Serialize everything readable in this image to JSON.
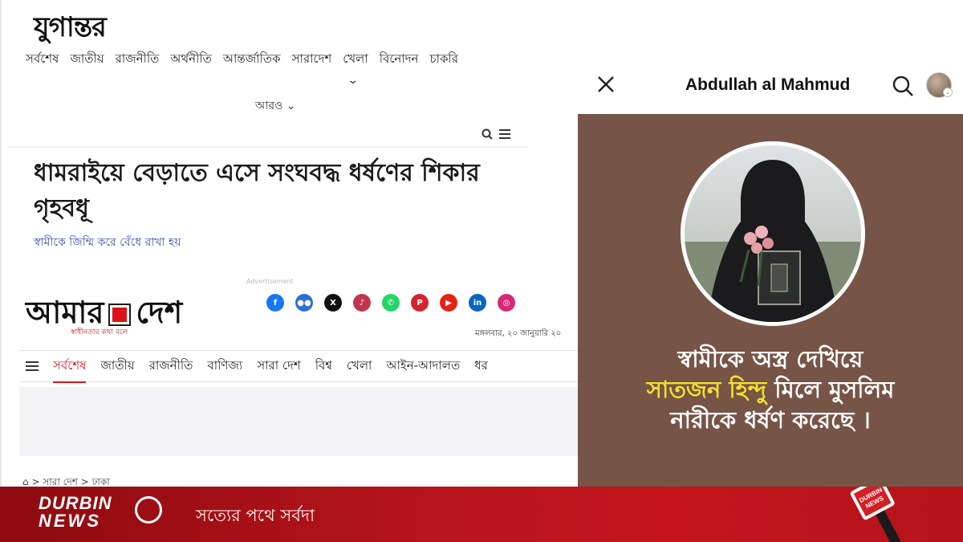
{
  "jugantor": {
    "logo": "যুগান্তর",
    "nav": [
      "সর্বশেষ",
      "জাতীয়",
      "রাজনীতি",
      "অর্থনীতি",
      "আন্তর্জাতিক",
      "সারাদেশ",
      "খেলা",
      "বিনোদন",
      "চাকরি"
    ],
    "more": "আরও",
    "headline": "ধামরাইয়ে বেড়াতে এসে সংঘবদ্ধ ধর্ষণের শিকার গৃহবধূ",
    "subheadline": "স্বামীকে জিম্মি করে বেঁধে রাখা হয়"
  },
  "amardesh": {
    "ad_label": "Advertisement",
    "logo_left": "আমার",
    "logo_right": "দেশ",
    "tagline": "স্বাধীনতার কথা বলে",
    "date": "মঙ্গলবার, ২০ জানুয়ারি ২০",
    "social": [
      "facebook",
      "community",
      "x",
      "tiktok",
      "whatsapp",
      "pinterest",
      "youtube",
      "linkedin",
      "instagram"
    ],
    "nav": [
      "সর্বশেষ",
      "জাতীয়",
      "রাজনীতি",
      "বাণিজ্য",
      "সারা দেশ",
      "বিশ্ব",
      "খেলা",
      "আইন-আদালত",
      "ধর"
    ],
    "breadcrumb": "> সারা দেশ > ঢাকা"
  },
  "fbpost": {
    "name": "Abdullah al Mahmud",
    "text_line1": "স্বামীকে অস্ত্র দেখিয়ে",
    "text_highlight": "সাতজন হিন্দু",
    "text_line2_rest": " মিলে মুসলিম",
    "text_line3": "নারীকে ধর্ষণ করেছে ।"
  },
  "banner": {
    "logo_line1": "DURBIN",
    "logo_line2": "NEWS",
    "slogan": "সত্যের পথে সর্বদা",
    "mic_label": "DURBIN NEWS"
  },
  "colors": {
    "card_bg": "#765547",
    "highlight": "#f3e12b",
    "banner_red": "#c4161c",
    "amardesh_red": "#d9151b"
  }
}
